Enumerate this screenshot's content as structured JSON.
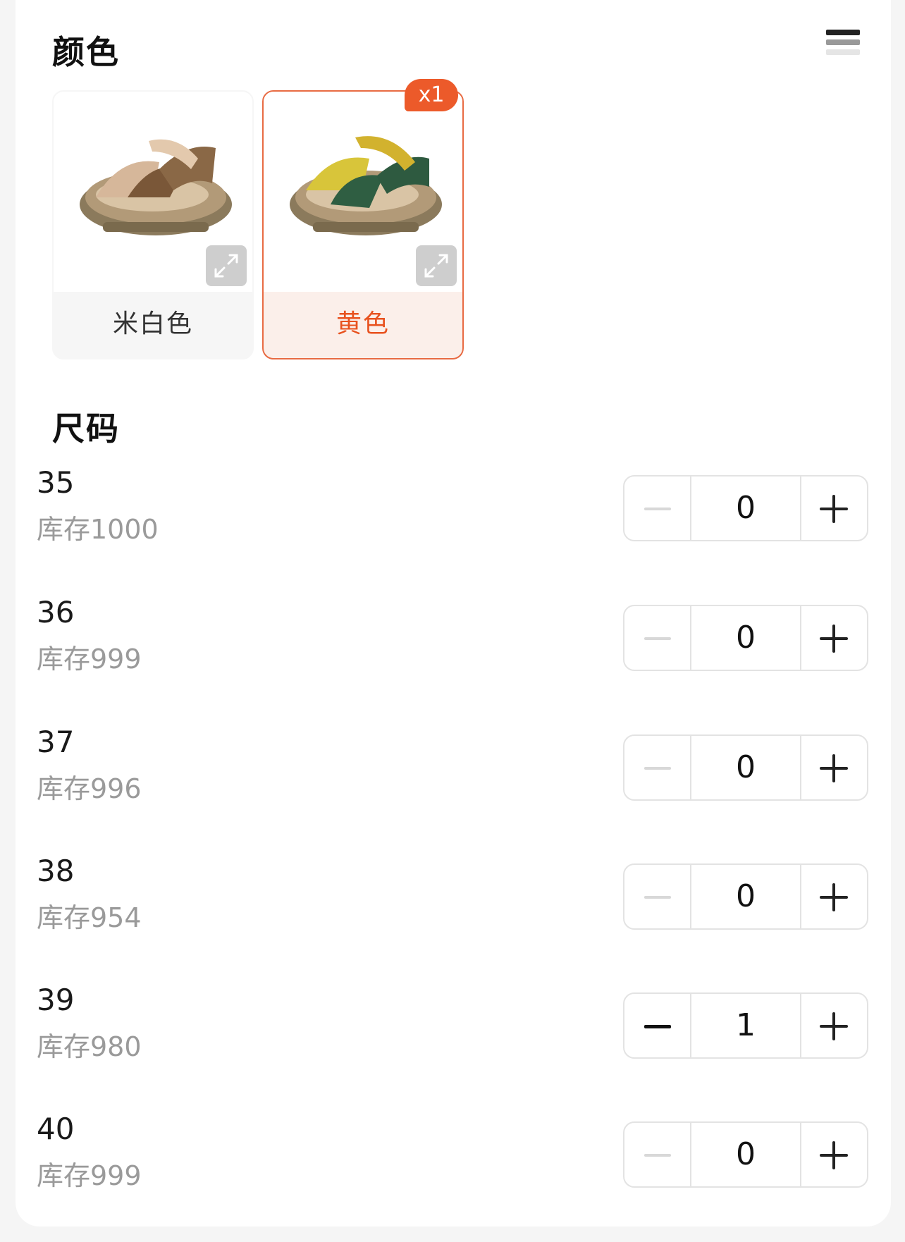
{
  "color_section": {
    "title": "颜色",
    "options": [
      {
        "label": "米白色",
        "selected": false
      },
      {
        "label": "黄色",
        "selected": true,
        "badge": "x1"
      }
    ]
  },
  "size_section": {
    "title": "尺码",
    "rows": [
      {
        "size": "35",
        "stock": "库存1000",
        "qty": "0"
      },
      {
        "size": "36",
        "stock": "库存999",
        "qty": "0"
      },
      {
        "size": "37",
        "stock": "库存996",
        "qty": "0"
      },
      {
        "size": "38",
        "stock": "库存954",
        "qty": "0"
      },
      {
        "size": "39",
        "stock": "库存980",
        "qty": "1"
      },
      {
        "size": "40",
        "stock": "库存999",
        "qty": "0"
      }
    ]
  },
  "icons": {
    "menu": "menu-icon",
    "expand": "expand-icon",
    "minus": "minus-icon",
    "plus": "plus-icon"
  },
  "colors": {
    "accent": "#e8521f",
    "badge": "#ec5a2a",
    "selected_bg": "#fbefea"
  }
}
